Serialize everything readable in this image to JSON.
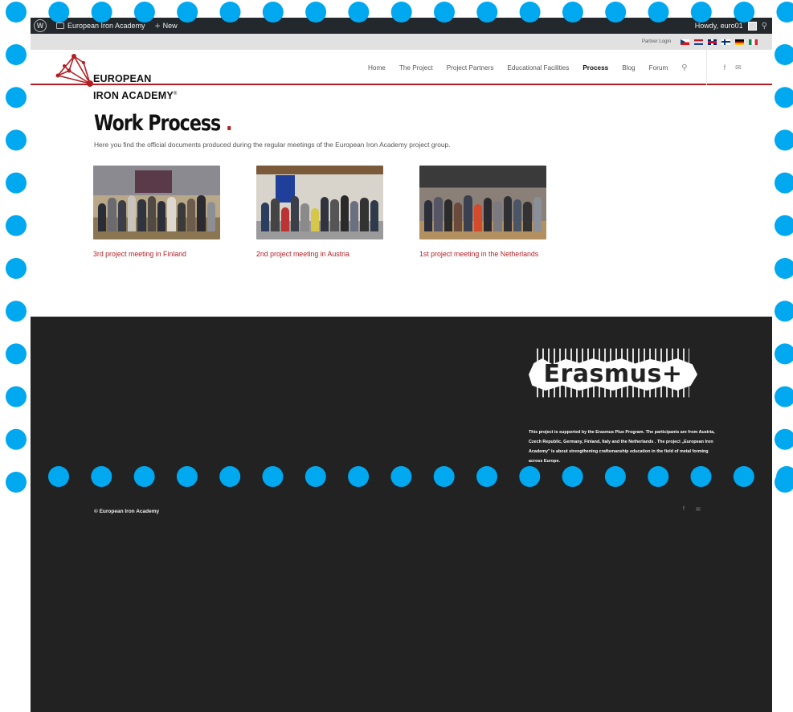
{
  "admin_bar": {
    "site_name": "European Iron Academy",
    "new_label": "New",
    "greeting": "Howdy, euro01"
  },
  "top_bar": {
    "partner_login": "Partner Login",
    "flags": [
      "cz",
      "nl",
      "gb",
      "fi",
      "de",
      "it"
    ]
  },
  "logo": {
    "line1": "EUROPEAN",
    "line2": "IRON ACADEMY",
    "mark": "®"
  },
  "nav": {
    "items": [
      "Home",
      "The Project",
      "Project Partners",
      "Educational Facilities",
      "Process",
      "Blog",
      "Forum"
    ],
    "active": "Process"
  },
  "page": {
    "title": "Work Process",
    "title_dot": ".",
    "subtitle": "Here you find the official documents produced during the regular meetings of the European Iron Academy project group."
  },
  "cards": [
    {
      "caption": "3rd project meeting in Finland"
    },
    {
      "caption": "2nd project meeting in Austria"
    },
    {
      "caption": "1st project meeting in the Netherlands"
    }
  ],
  "footer": {
    "erasmus": "Erasmus+",
    "text": "This project is supported by the Erasmus Plus Program. The participants are from Austria, Czech Republic, Germany, Finland, Italy and the Netherlands . The project „European Iron Academy\" is about strengthening craftsmanship education in the field of metal forming across Europe.",
    "copyright": "© European Iron Academy"
  },
  "colors": {
    "accent": "#b21e23",
    "admin_bar": "#23282d",
    "footer_bg": "#222222",
    "dots": "#00a8f0"
  }
}
